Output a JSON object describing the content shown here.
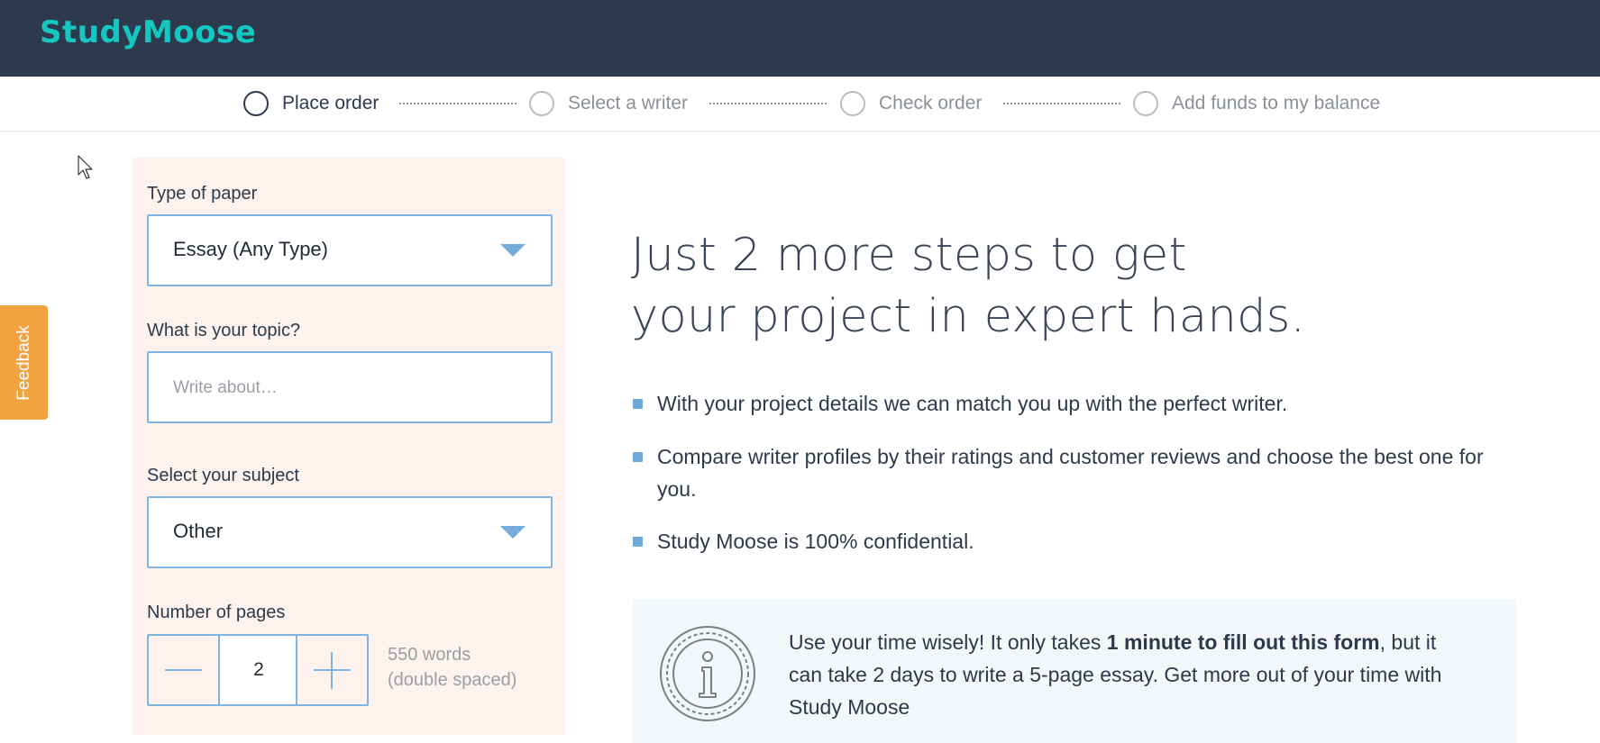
{
  "header": {
    "logo": "StudyMoose"
  },
  "steps": [
    {
      "label": "Place order",
      "active": true
    },
    {
      "label": "Select a writer",
      "active": false
    },
    {
      "label": "Check order",
      "active": false
    },
    {
      "label": "Add funds to my balance",
      "active": false
    }
  ],
  "feedback": {
    "label": "Feedback"
  },
  "form": {
    "paper_type": {
      "label": "Type of paper",
      "value": "Essay (Any Type)"
    },
    "topic": {
      "label": "What is your topic?",
      "placeholder": "Write about…"
    },
    "subject": {
      "label": "Select your subject",
      "value": "Other"
    },
    "pages": {
      "label": "Number of pages",
      "value": "2",
      "words_line1": "550 words",
      "words_line2": "(double spaced)"
    }
  },
  "promo": {
    "headline_line1": "Just 2 more steps to get",
    "headline_line2": "your project in expert hands.",
    "bullets": [
      "With your project details we can match you up with the perfect writer.",
      "Compare writer profiles by their ratings and customer reviews and choose the best one for you.",
      "Study Moose is 100% confidential."
    ],
    "info": {
      "text_before": "Use your time wisely! It only takes ",
      "text_bold": "1 minute to fill out this form",
      "text_after": ", but it can take 2 days to write a 5-page essay. Get more out of your time with Study Moose"
    }
  },
  "colors": {
    "header_bg": "#2d3a4e",
    "logo": "#14c7c1",
    "form_panel_bg": "#fdf2ee",
    "field_border": "#7fb5e1",
    "feedback_bg": "#f0a33e",
    "info_box_bg": "#f4f7f9"
  }
}
